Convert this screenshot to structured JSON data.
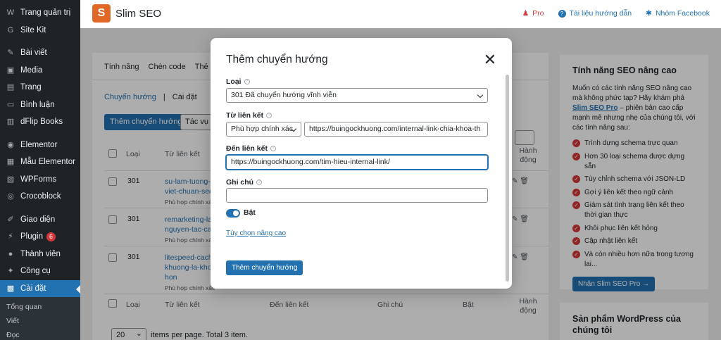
{
  "sidebar": {
    "items": [
      {
        "icon": "wordpress-icon",
        "glyph": "W",
        "label": "Trang quản trị"
      },
      {
        "icon": "sitekit-icon",
        "glyph": "G",
        "label": "Site Kit"
      },
      {
        "icon": "pin-icon",
        "glyph": "✎",
        "label": "Bài viết"
      },
      {
        "icon": "media-icon",
        "glyph": "▣",
        "label": "Media"
      },
      {
        "icon": "page-icon",
        "glyph": "▤",
        "label": "Trang"
      },
      {
        "icon": "comment-icon",
        "glyph": "▭",
        "label": "Bình luận"
      },
      {
        "icon": "dflip-icon",
        "glyph": "▥",
        "label": "dFlip Books"
      },
      {
        "icon": "elementor-icon",
        "glyph": "◉",
        "label": "Elementor"
      },
      {
        "icon": "template-icon",
        "glyph": "▦",
        "label": "Mẫu Elementor"
      },
      {
        "icon": "wpforms-icon",
        "glyph": "▧",
        "label": "WPForms"
      },
      {
        "icon": "crocoblock-icon",
        "glyph": "◎",
        "label": "Crocoblock"
      },
      {
        "icon": "appearance-icon",
        "glyph": "✐",
        "label": "Giao diện"
      },
      {
        "icon": "plugin-icon",
        "glyph": "⚡",
        "label": "Plugin",
        "badge": "6"
      },
      {
        "icon": "users-icon",
        "glyph": "●",
        "label": "Thành viên"
      },
      {
        "icon": "tools-icon",
        "glyph": "✦",
        "label": "Công cụ"
      },
      {
        "icon": "settings-icon",
        "glyph": "▩",
        "label": "Cài đặt"
      }
    ],
    "submenu": [
      "Tổng quan",
      "Viết",
      "Đọc"
    ]
  },
  "topbar": {
    "logo_letter": "S",
    "brand": "Slim SEO",
    "links": [
      {
        "icon": "pro-icon",
        "glyph": "♟",
        "label": "Pro",
        "color": "#d63638"
      },
      {
        "icon": "help-icon",
        "glyph": "?",
        "label": "Tài liệu hướng dẫn",
        "color": "#2271b1"
      },
      {
        "icon": "facebook-group-icon",
        "glyph": "✱",
        "label": "Nhóm Facebook",
        "color": "#2271b1"
      }
    ]
  },
  "main": {
    "tabs": [
      "Tính năng",
      "Chèn code",
      "Thẻ M"
    ],
    "subnav": {
      "link": "Chuyển hướng",
      "sep": "|",
      "current": "Cài đặt"
    },
    "add_button": "Thêm chuyển hướng",
    "bulk_select": "Tác vụ h",
    "columns": [
      "Loại",
      "Từ liên kết",
      "Đến liên kết",
      "Ghi chú",
      "Bật",
      "Hành động"
    ],
    "rows": [
      {
        "type": "301",
        "from_lines": [
          "su-lam-tuong-t",
          "viet-chuan-seo"
        ],
        "match": "Phù hợp chính xác"
      },
      {
        "type": "301",
        "from_lines": [
          "remarketing-la-",
          "nguyen-tac-cac"
        ],
        "match": "Phù hợp chính xác"
      },
      {
        "type": "301",
        "from_lines": [
          "litespeed-cach",
          "khuong-la-kho",
          "hon"
        ],
        "match": "Phù hợp chính xác"
      }
    ],
    "footer": {
      "per_page": "20",
      "text": "items per page. Total 3 item."
    }
  },
  "right_panel": {
    "title": "Tính năng SEO nâng cao",
    "intro_before": "Muốn có các tính năng SEO nâng cao mà không phức tạp? Hãy khám phá ",
    "intro_link": "Slim SEO Pro",
    "intro_after": " – phiên bản cao cấp mạnh mẽ nhưng nhẹ của chúng tôi, với các tính năng sau:",
    "features": [
      "Trình dựng schema trực quan",
      "Hơn 30 loại schema được dựng sẵn",
      "Tùy chỉnh schema với JSON-LD",
      "Gợi ý liên kết theo ngữ cảnh",
      "Giám sát tình trạng liên kết theo thời gian thực",
      "Khôi phục liên kết hỏng",
      "Cập nhật liên kết",
      "Và còn nhiều hơn nữa trong tương lai..."
    ],
    "cta": "Nhận Slim SEO Pro →"
  },
  "right_panel2": {
    "title": "Sản phẩm WordPress của chúng tôi"
  },
  "modal": {
    "title": "Thêm chuyển hướng",
    "close_glyph": "✕",
    "type_label": "Loại",
    "type_value": "301 Đã chuyển hướng vĩnh viễn",
    "from_label": "Từ liên kết",
    "from_match_value": "Phù hợp chính xác",
    "from_value": "https://buingockhuong.com/internal-link-chia-khoa-th",
    "to_label": "Đến liên kết",
    "to_value": "https://buingockhuong.com/tim-hieu-internal-link/",
    "note_label": "Ghi chú",
    "note_value": "",
    "enabled_label": "Bật",
    "enabled": true,
    "advanced_link": "Tùy chọn nâng cao",
    "submit": "Thêm chuyển hướng"
  },
  "colors": {
    "accent": "#2271b1",
    "sidebar_bg": "#1d2327",
    "brand_logo": "#e06725",
    "danger": "#d63638"
  }
}
